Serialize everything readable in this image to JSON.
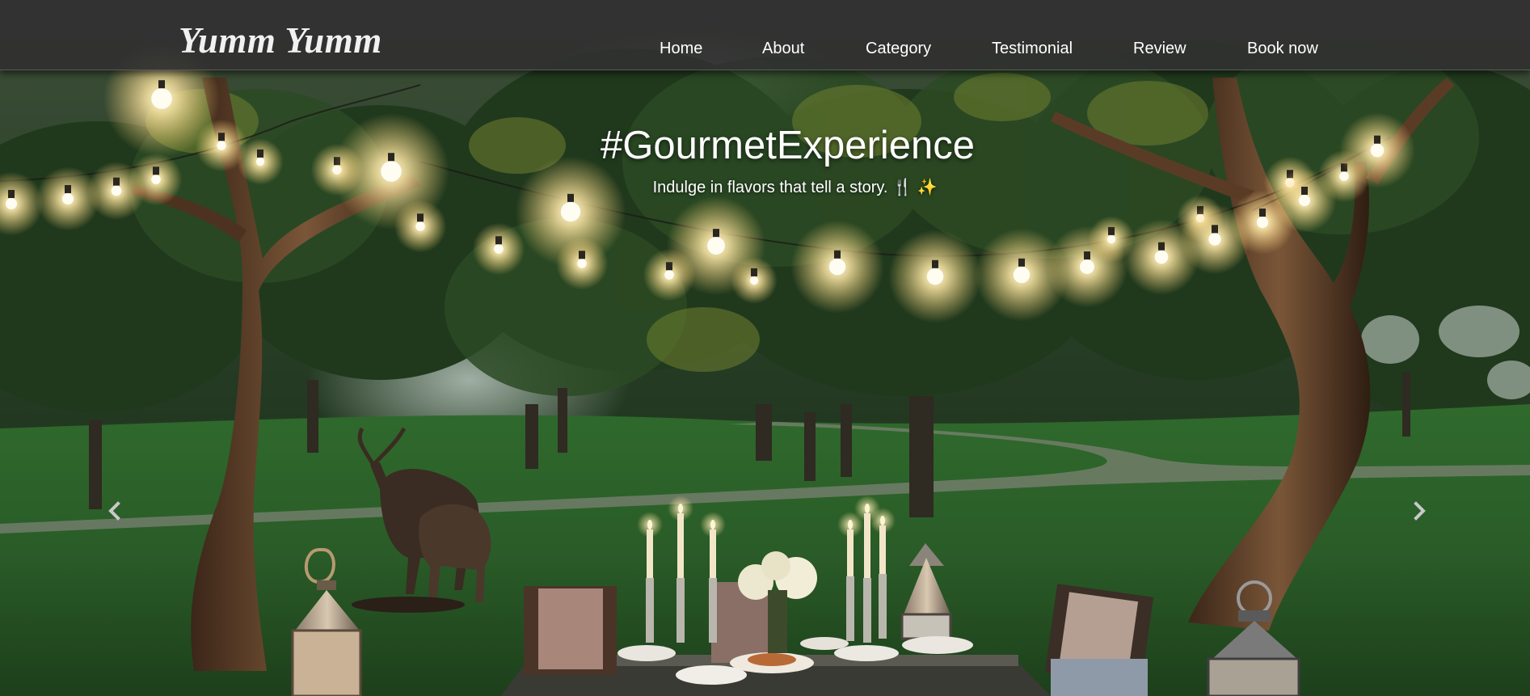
{
  "header": {
    "brand": "Yumm Yumm",
    "nav": [
      {
        "label": "Home"
      },
      {
        "label": "About"
      },
      {
        "label": "Category"
      },
      {
        "label": "Testimonial"
      },
      {
        "label": "Review"
      },
      {
        "label": "Book now"
      }
    ]
  },
  "hero": {
    "title": "#GourmetExperience",
    "tagline": "Indulge in flavors that tell a story. 🍴 ✨",
    "image": "outdoor-dinner-string-lights-photo"
  },
  "carousel": {
    "prev_icon": "chevron-left-icon",
    "next_icon": "chevron-right-icon"
  },
  "colors": {
    "navbar_bg": "#303030",
    "text": "#ffffff",
    "grass": "#2d5a2b",
    "foliage": "#1e3a1a",
    "bulb_glow": "#fff3c9"
  }
}
